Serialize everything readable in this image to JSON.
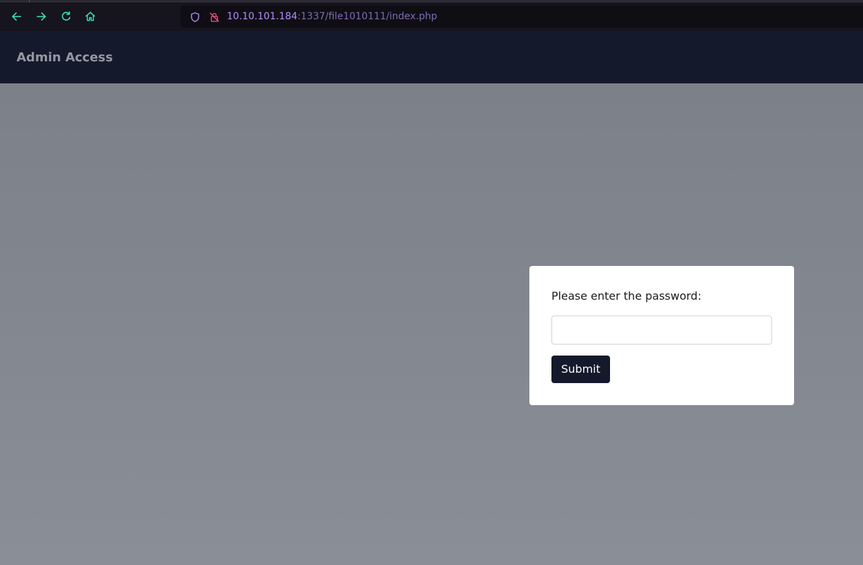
{
  "browser": {
    "url_host": "10.10.101.184",
    "url_path": ":1337/file1010111/index.php",
    "icons": {
      "back": "arrow-left-icon",
      "forward": "arrow-right-icon",
      "reload": "reload-icon",
      "home": "home-icon",
      "tracking_protection": "shield-icon",
      "connection": "insecure-lock-icon"
    },
    "colors": {
      "toolbar_bg": "#16141f",
      "nav_icon": "#3ee3b0",
      "url_host": "#b48cff",
      "url_path": "#7f6bb3",
      "insecure_icon": "#ff4f8b"
    }
  },
  "header": {
    "title": "Admin Access"
  },
  "login": {
    "prompt": "Please enter the password:",
    "password_value": "",
    "submit_label": "Submit"
  },
  "colors": {
    "header_bg": "#141a2c",
    "page_bg": "#878b94",
    "card_bg": "#ffffff",
    "button_bg": "#141a2c"
  }
}
